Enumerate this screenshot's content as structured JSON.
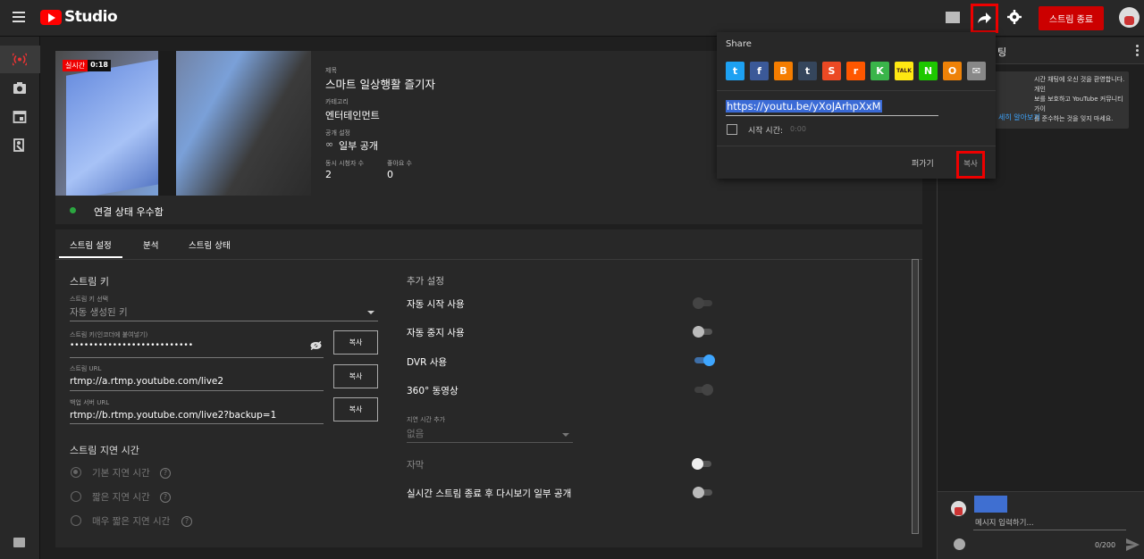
{
  "app": {
    "name": "Studio"
  },
  "header": {
    "end_stream_label": "스트림 종료"
  },
  "stream": {
    "live_label": "실시간",
    "duration": "0:18",
    "title_label": "제목",
    "title": "스마트 일상행활 즐기자",
    "category_label": "카테고리",
    "category": "엔터테인먼트",
    "privacy_label": "공개 설정",
    "privacy": "일부 공개",
    "viewers_label": "동시 시청자 수",
    "viewers": "2",
    "likes_label": "좋아요 수",
    "likes": "0",
    "connection_status": "연결 상태 우수함"
  },
  "tabs": [
    "스트림 설정",
    "분석",
    "스트림 상태"
  ],
  "stream_key": {
    "section_title": "스트림 키",
    "select_label": "스트림 키 선택",
    "select_value": "자동 생성된 키",
    "key_label": "스트림 키(인코더에 붙여넣기)",
    "key_value": "••••••••••••••••••••••••••",
    "url_label": "스트림 URL",
    "url_value": "rtmp://a.rtmp.youtube.com/live2",
    "backup_label": "백업 서버 URL",
    "backup_value": "rtmp://b.rtmp.youtube.com/live2?backup=1",
    "copy_label": "복사"
  },
  "latency": {
    "section_title": "스트림 지연 시간",
    "options": [
      "기본 지연 시간",
      "짧은 지연 시간",
      "매우 짧은 지연 시간"
    ],
    "help": "?"
  },
  "additional": {
    "section_title": "추가 설정",
    "auto_start": "자동 시작 사용",
    "auto_stop": "자동 중지 사용",
    "dvr": "DVR 사용",
    "video360": "360° 동영상",
    "delay_label": "지연 시간 추가",
    "delay_value": "없음",
    "captions": "자막",
    "unlist": "실시간 스트림 종료 후 다시보기 일부 공개"
  },
  "chat": {
    "title_fragment": "팅",
    "notice_line1": "시간 채팅에 오신 것을 환영합니다. 개인",
    "notice_line2": "보를 보호하고 YouTube 커뮤니티 가이",
    "notice_line3": "를 준수하는 것을 잊지 마세요.",
    "notice_link": "세히 알아보기",
    "input_placeholder": "메시지 입력하기...",
    "counter": "0/200"
  },
  "share": {
    "title": "Share",
    "url": "https://youtu.be/yXoJArhpXxM",
    "start_label": "시작 시간:",
    "start_value": "0:00",
    "embed_label": "퍼가기",
    "copy_label": "복사",
    "networks": [
      {
        "name": "twitter-icon",
        "color": "#1da1f2",
        "glyph": "t"
      },
      {
        "name": "facebook-icon",
        "color": "#3b5998",
        "glyph": "f"
      },
      {
        "name": "blogger-icon",
        "color": "#f57d00",
        "glyph": "B"
      },
      {
        "name": "tumblr-icon",
        "color": "#35465c",
        "glyph": "t"
      },
      {
        "name": "stumbleupon-icon",
        "color": "#eb4924",
        "glyph": "S"
      },
      {
        "name": "reddit-icon",
        "color": "#ff5700",
        "glyph": "r"
      },
      {
        "name": "kakaostory-icon",
        "color": "#3ab54a",
        "glyph": "K"
      },
      {
        "name": "kakaotalk-icon",
        "color": "#ffe812",
        "glyph": "TALK"
      },
      {
        "name": "naver-icon",
        "color": "#1ec800",
        "glyph": "N"
      },
      {
        "name": "odnoklassniki-icon",
        "color": "#ee8208",
        "glyph": "O"
      },
      {
        "name": "email-icon",
        "color": "#888888",
        "glyph": "✉"
      }
    ]
  }
}
